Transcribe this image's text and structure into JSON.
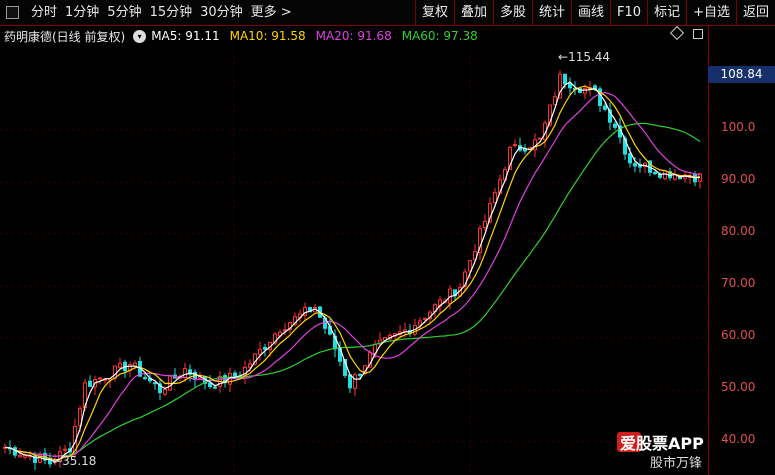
{
  "toolbar": {
    "timeframes": [
      "分时",
      "1分钟",
      "5分钟",
      "15分钟",
      "30分钟",
      "更多 >"
    ],
    "tools": [
      "复权",
      "叠加",
      "多股",
      "统计",
      "画线",
      "F10",
      "标记",
      "+自选",
      "返回"
    ]
  },
  "stock": {
    "name": "药明康德(日线 前复权)",
    "ma": [
      {
        "label": "MA5: 91.11",
        "color": "#ffffff"
      },
      {
        "label": "MA10: 91.58",
        "color": "#ffd400"
      },
      {
        "label": "MA20: 91.68",
        "color": "#e040e0"
      },
      {
        "label": "MA60: 97.38",
        "color": "#30d030"
      }
    ]
  },
  "axis": {
    "ticks": [
      "100.0",
      "90.00",
      "80.00",
      "70.00",
      "60.00",
      "50.00",
      "40.00"
    ],
    "current_price": "108.84"
  },
  "annotations": {
    "high": "115.44",
    "low": "35.18"
  },
  "watermark": {
    "brand": "爱股票APP",
    "sub": "股市万锋"
  },
  "colors": {
    "up": "#ff3030",
    "down": "#20e0e0",
    "ma5": "#ffffff",
    "ma10": "#ffd400",
    "ma20": "#e040e0",
    "ma60": "#30d030"
  }
}
